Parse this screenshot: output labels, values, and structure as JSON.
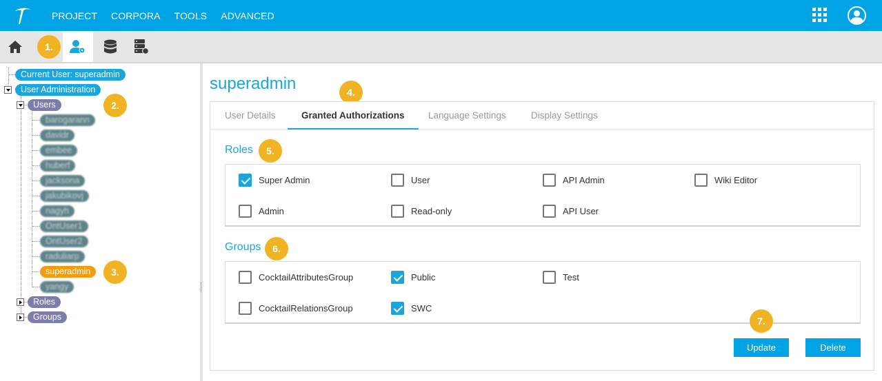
{
  "colors": {
    "brand": "#00a4e4",
    "accent": "#1aa6dd",
    "marker": "#f0b323",
    "selected_node": "#f39c12"
  },
  "topnav": {
    "menu": [
      "PROJECT",
      "CORPORA",
      "TOOLS",
      "ADVANCED"
    ],
    "icons": [
      "logo-icon",
      "apps-grid-icon",
      "user-account-icon"
    ]
  },
  "toolbar": {
    "icons": [
      "home-icon",
      "user-admin-icon",
      "database-icon",
      "server-icon"
    ],
    "active": "user-admin-icon"
  },
  "markers": [
    "1.",
    "2.",
    "3.",
    "4.",
    "5.",
    "6.",
    "7."
  ],
  "tree": {
    "current_user": "Current User: superadmin",
    "admin": "User Administration",
    "users_label": "Users",
    "users": [
      "barogarann",
      "davidr",
      "embee",
      "huberf",
      "jacksona",
      "jakubikovj",
      "nagyh",
      "OntUser1",
      "OntUser2",
      "raduliarp",
      "superadmin",
      "yangy"
    ],
    "roles_label": "Roles",
    "groups_label": "Groups"
  },
  "main": {
    "title": "superadmin",
    "tabs": [
      "User Details",
      "Granted Authorizations",
      "Language Settings",
      "Display Settings"
    ],
    "active_tab": "Granted Authorizations",
    "roles_title": "Roles",
    "roles": [
      {
        "label": "Super Admin",
        "checked": true
      },
      {
        "label": "User",
        "checked": false
      },
      {
        "label": "API Admin",
        "checked": false
      },
      {
        "label": "Wiki Editor",
        "checked": false
      },
      {
        "label": "Admin",
        "checked": false
      },
      {
        "label": "Read-only",
        "checked": false
      },
      {
        "label": "API User",
        "checked": false
      }
    ],
    "groups_title": "Groups",
    "groups": [
      {
        "label": "CocktailAttributesGroup",
        "checked": false
      },
      {
        "label": "Public",
        "checked": true
      },
      {
        "label": "Test",
        "checked": false
      },
      {
        "label": "CocktailRelationsGroup",
        "checked": false
      },
      {
        "label": "SWC",
        "checked": true
      }
    ],
    "update_label": "Update",
    "delete_label": "Delete"
  }
}
